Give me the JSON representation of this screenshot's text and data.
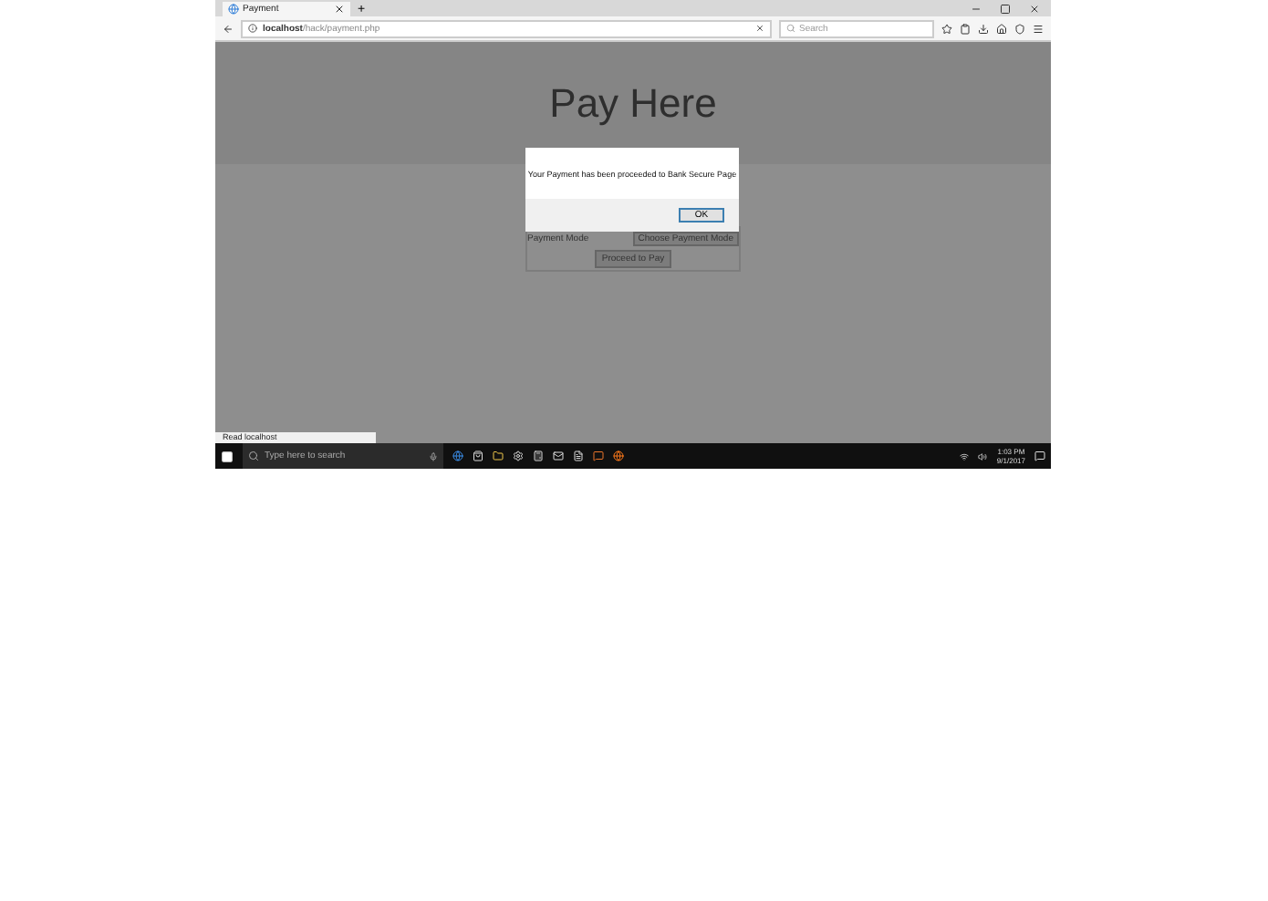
{
  "browser": {
    "tab_title": "Payment",
    "new_tab": "+",
    "url_host": "localhost",
    "url_path": "/hack/payment.php",
    "search_placeholder": "Search"
  },
  "page": {
    "heading": "Pay Here",
    "payment_mode_label": "Payment Mode",
    "payment_mode_select": "Choose Payment Mode",
    "submit_button": "Proceed to Pay"
  },
  "alert": {
    "message": "Your Payment has been proceeded to Bank Secure Page",
    "ok_button": "OK"
  },
  "status_bar": "Read localhost",
  "taskbar": {
    "search_placeholder": "Type here to search",
    "time": "1:03 PM",
    "date": "9/1/2017"
  }
}
